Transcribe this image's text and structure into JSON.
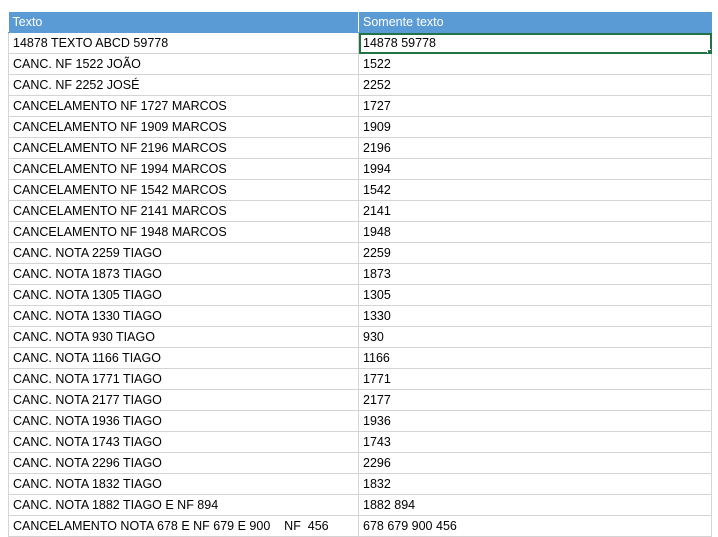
{
  "sheet": {
    "accent_color": "#5b9bd5",
    "selection_color": "#217346",
    "headers": [
      "Texto",
      "Somente texto"
    ],
    "rows": [
      [
        "14878 TEXTO ABCD 59778",
        "14878 59778"
      ],
      [
        "CANC. NF 1522 JOÃO",
        "1522"
      ],
      [
        "CANC. NF 2252 JOSÉ",
        "2252"
      ],
      [
        "CANCELAMENTO NF 1727 MARCOS",
        "1727"
      ],
      [
        "CANCELAMENTO NF 1909 MARCOS",
        "1909"
      ],
      [
        "CANCELAMENTO NF 2196 MARCOS",
        "2196"
      ],
      [
        "CANCELAMENTO NF 1994 MARCOS",
        "1994"
      ],
      [
        "CANCELAMENTO NF 1542 MARCOS",
        "1542"
      ],
      [
        "CANCELAMENTO NF 2141 MARCOS",
        "2141"
      ],
      [
        "CANCELAMENTO NF 1948 MARCOS",
        "1948"
      ],
      [
        "CANC. NOTA 2259 TIAGO",
        "2259"
      ],
      [
        "CANC. NOTA 1873 TIAGO",
        "1873"
      ],
      [
        "CANC. NOTA 1305 TIAGO",
        "1305"
      ],
      [
        "CANC. NOTA 1330 TIAGO",
        "1330"
      ],
      [
        "CANC. NOTA 930 TIAGO",
        "930"
      ],
      [
        "CANC. NOTA 1166 TIAGO",
        "1166"
      ],
      [
        "CANC. NOTA 1771 TIAGO",
        "1771"
      ],
      [
        "CANC. NOTA 2177 TIAGO",
        "2177"
      ],
      [
        "CANC. NOTA 1936 TIAGO",
        "1936"
      ],
      [
        "CANC. NOTA 1743 TIAGO",
        "1743"
      ],
      [
        "CANC. NOTA 2296 TIAGO",
        "2296"
      ],
      [
        "CANC. NOTA 1832 TIAGO",
        "1832"
      ],
      [
        "CANC. NOTA 1882 TIAGO E NF 894",
        "1882 894"
      ],
      [
        "CANCELAMENTO NOTA 678 E NF 679 E 900    NF  456",
        "678 679 900 456"
      ]
    ]
  }
}
